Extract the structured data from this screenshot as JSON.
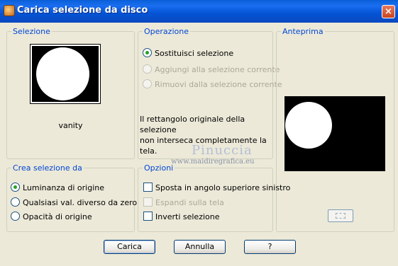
{
  "window": {
    "title": "Carica selezione da disco",
    "close": "×"
  },
  "selezione": {
    "label": "Selezione",
    "filename": "vanity"
  },
  "operazione": {
    "label": "Operazione",
    "options": [
      "Sostituisci selezione",
      "Aggiungi alla selezione corrente",
      "Rimuovi dalla selezione corrente"
    ],
    "selected": 0,
    "message": [
      "Il rettangolo originale della selezione",
      "non interseca completamente la tela."
    ]
  },
  "anteprima": {
    "label": "Anteprima"
  },
  "crea": {
    "label": "Crea selezione da",
    "options": [
      "Luminanza di origine",
      "Qualsiasi val. diverso da zero",
      "Opacità di origine"
    ],
    "selected": 0
  },
  "opzioni": {
    "label": "Opzioni",
    "checks": [
      "Sposta in angolo superiore sinistro",
      "Espandi sulla tela",
      "Inverti selezione"
    ]
  },
  "watermark": {
    "name": "Pinuccia",
    "site": "www.maidiregrafica.eu"
  },
  "buttons": {
    "ok": "Carica",
    "cancel": "Annulla",
    "help": "?"
  }
}
